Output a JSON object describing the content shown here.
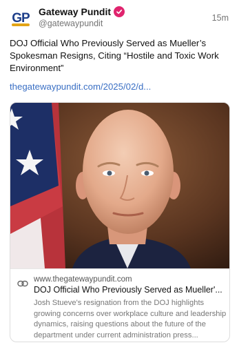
{
  "post": {
    "display_name": "Gateway Pundit",
    "handle": "@gatewaypundit",
    "time": "15m",
    "avatar_text": "GP",
    "text": "DOJ Official Who Previously Served as Mueller’s Spokesman Resigns, Citing “Hostile and Toxic Work Environment”",
    "link": "thegatewaypundit.com/2025/02/d..."
  },
  "card": {
    "domain": "www.thegatewaypundit.com",
    "title": "DOJ Official Who Previously Served as Mueller'...",
    "description": "Josh Stueve's resignation from the DOJ highlights growing concerns over workplace culture and leadership dynamics, raising questions about the future of the department under current administration press..."
  },
  "icons": {
    "verified": "verified-badge-icon",
    "link": "link-icon"
  },
  "colors": {
    "accent_link": "#3a6fc4",
    "verified_badge": "#e0246e",
    "avatar_brand": "#1d3e8a"
  }
}
